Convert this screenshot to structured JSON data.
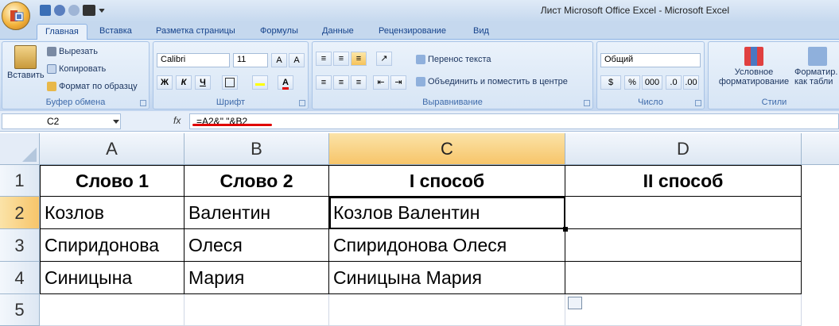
{
  "window": {
    "title": "Лист Microsoft Office Excel - Microsoft Excel"
  },
  "ribbon": {
    "tabs": [
      "Главная",
      "Вставка",
      "Разметка страницы",
      "Формулы",
      "Данные",
      "Рецензирование",
      "Вид"
    ],
    "clipboard": {
      "paste": "Вставить",
      "cut": "Вырезать",
      "copy": "Копировать",
      "format_painter": "Формат по образцу",
      "label": "Буфер обмена"
    },
    "font": {
      "name": "Calibri",
      "size": "11",
      "bold": "Ж",
      "italic": "К",
      "underline": "Ч",
      "label": "Шрифт"
    },
    "alignment": {
      "wrap": "Перенос текста",
      "merge": "Объединить и поместить в центре",
      "label": "Выравнивание"
    },
    "number": {
      "format": "Общий",
      "percent": "%",
      "thousands": "000",
      "label": "Число"
    },
    "styles": {
      "conditional": "Условное форматирование",
      "format_table": "Форматир. как табли",
      "label": "Стили"
    }
  },
  "formula_bar": {
    "cell_ref": "C2",
    "fx": "fx",
    "formula": "=A2&\" \"&B2"
  },
  "sheet": {
    "columns": [
      "A",
      "B",
      "C",
      "D"
    ],
    "rows": [
      "1",
      "2",
      "3",
      "4",
      "5"
    ],
    "headers": {
      "A": "Слово 1",
      "B": "Слово 2",
      "C": "I способ",
      "D": "II способ"
    },
    "data": [
      {
        "A": "Козлов",
        "B": "Валентин",
        "C": "Козлов Валентин",
        "D": ""
      },
      {
        "A": "Спиридонова",
        "B": "Олеся",
        "C": "Спиридонова Олеся",
        "D": ""
      },
      {
        "A": "Синицына",
        "B": "Мария",
        "C": "Синицына Мария",
        "D": ""
      }
    ]
  }
}
